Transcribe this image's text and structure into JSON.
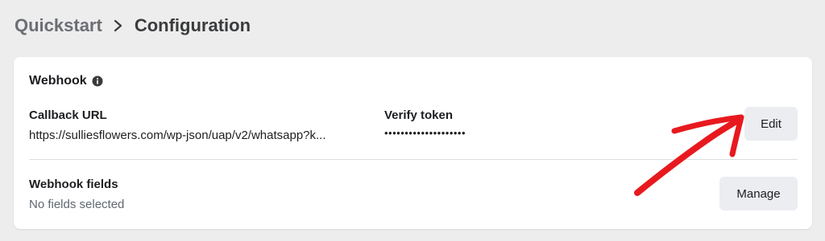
{
  "breadcrumb": {
    "parent": "Quickstart",
    "current": "Configuration"
  },
  "webhook": {
    "title": "Webhook",
    "callback_url_label": "Callback URL",
    "callback_url_value": "https://sulliesflowers.com/wp-json/uap/v2/whatsapp?k...",
    "verify_token_label": "Verify token",
    "verify_token_value": "••••••••••••••••••••",
    "edit_label": "Edit"
  },
  "webhook_fields": {
    "title": "Webhook fields",
    "status": "No fields selected",
    "manage_label": "Manage"
  },
  "colors": {
    "annotation_arrow": "#e8191e",
    "button_bg": "#ebedf0",
    "page_bg": "#ededed"
  },
  "icons": {
    "breadcrumb_separator": "chevron-right-icon",
    "webhook_info": "info-icon"
  }
}
